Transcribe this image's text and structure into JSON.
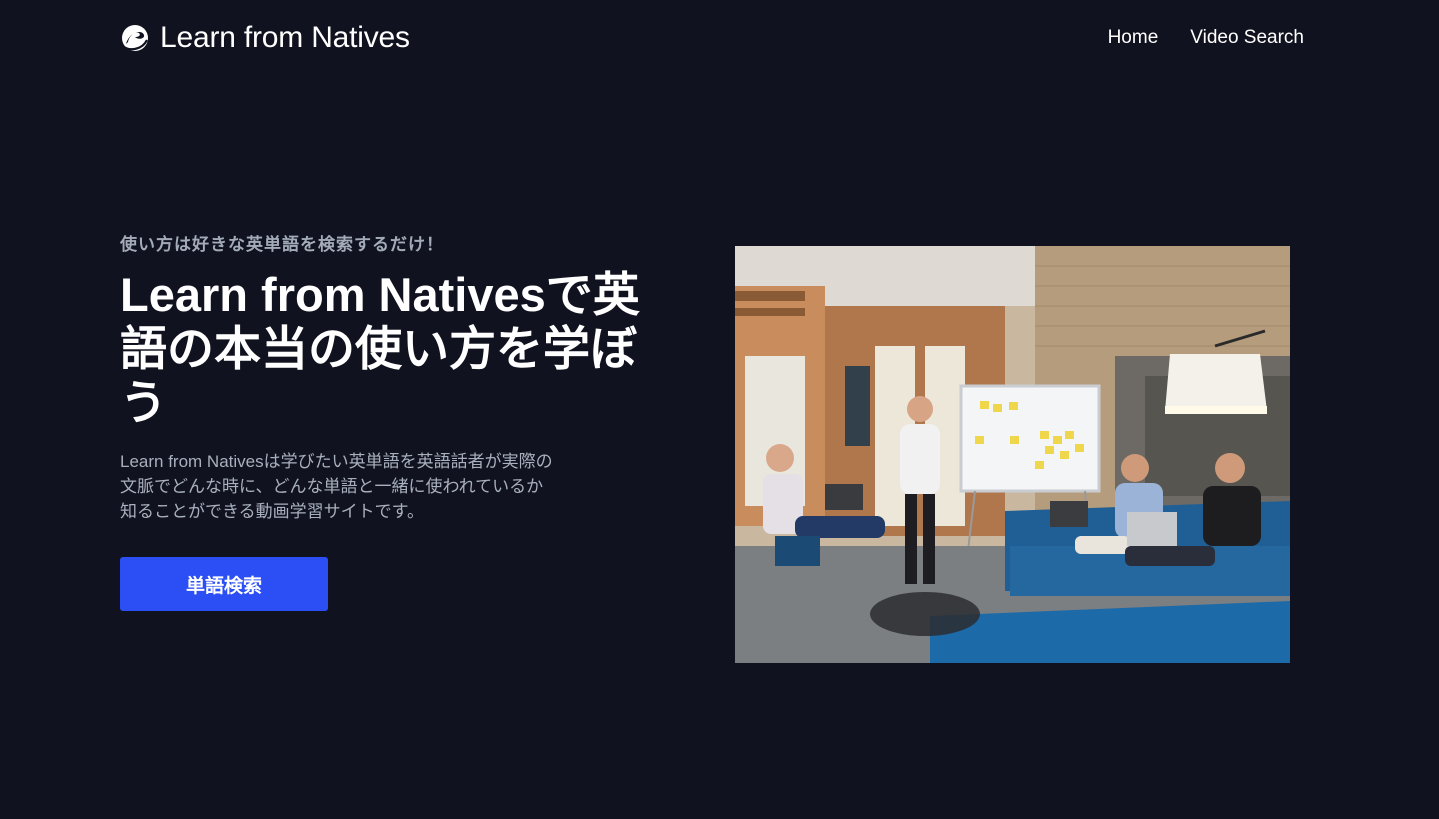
{
  "header": {
    "brand_name": "Learn from Natives",
    "logo_icon": "swirl-logo-icon",
    "nav": [
      {
        "label": "Home"
      },
      {
        "label": "Video Search"
      }
    ]
  },
  "hero": {
    "eyebrow": "使い方は好きな英単語を検索するだけ！",
    "headline": "Learn from Nativesで英語の本当の使い方を学ぼう",
    "description": "Learn from Nativesは学びたい英単語を英語話者が実際の文脈でどんな時に、どんな単語と一緒に使われているか知ることができる動画学習サイトです。",
    "cta_label": "単語検索",
    "image_alt": "team-meeting-photo"
  },
  "colors": {
    "background": "#10121f",
    "accent": "#2b4ff5",
    "muted_text": "#a9b0bd"
  }
}
